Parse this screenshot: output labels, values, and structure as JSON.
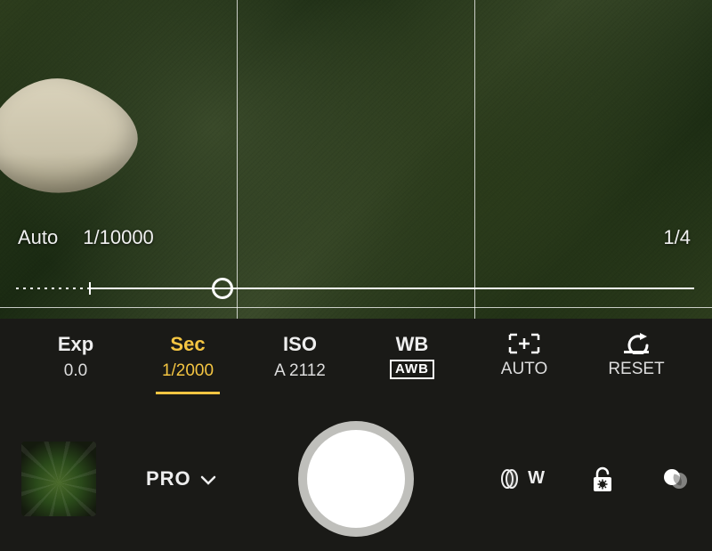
{
  "colors": {
    "accent": "#f4c542"
  },
  "slider": {
    "min_label": "Auto",
    "fast_label": "1/10000",
    "slow_label": "1/4"
  },
  "settings": {
    "exp": {
      "label": "Exp",
      "value": "0.0"
    },
    "sec": {
      "label": "Sec",
      "value": "1/2000"
    },
    "iso": {
      "label": "ISO",
      "value": "A 2112"
    },
    "wb": {
      "label": "WB",
      "value": "AWB"
    },
    "meter": {
      "label": "[+]",
      "value": "AUTO"
    },
    "reset": {
      "label": "↶",
      "value": "RESET"
    }
  },
  "bottom": {
    "mode": "PRO",
    "lens": "W"
  }
}
